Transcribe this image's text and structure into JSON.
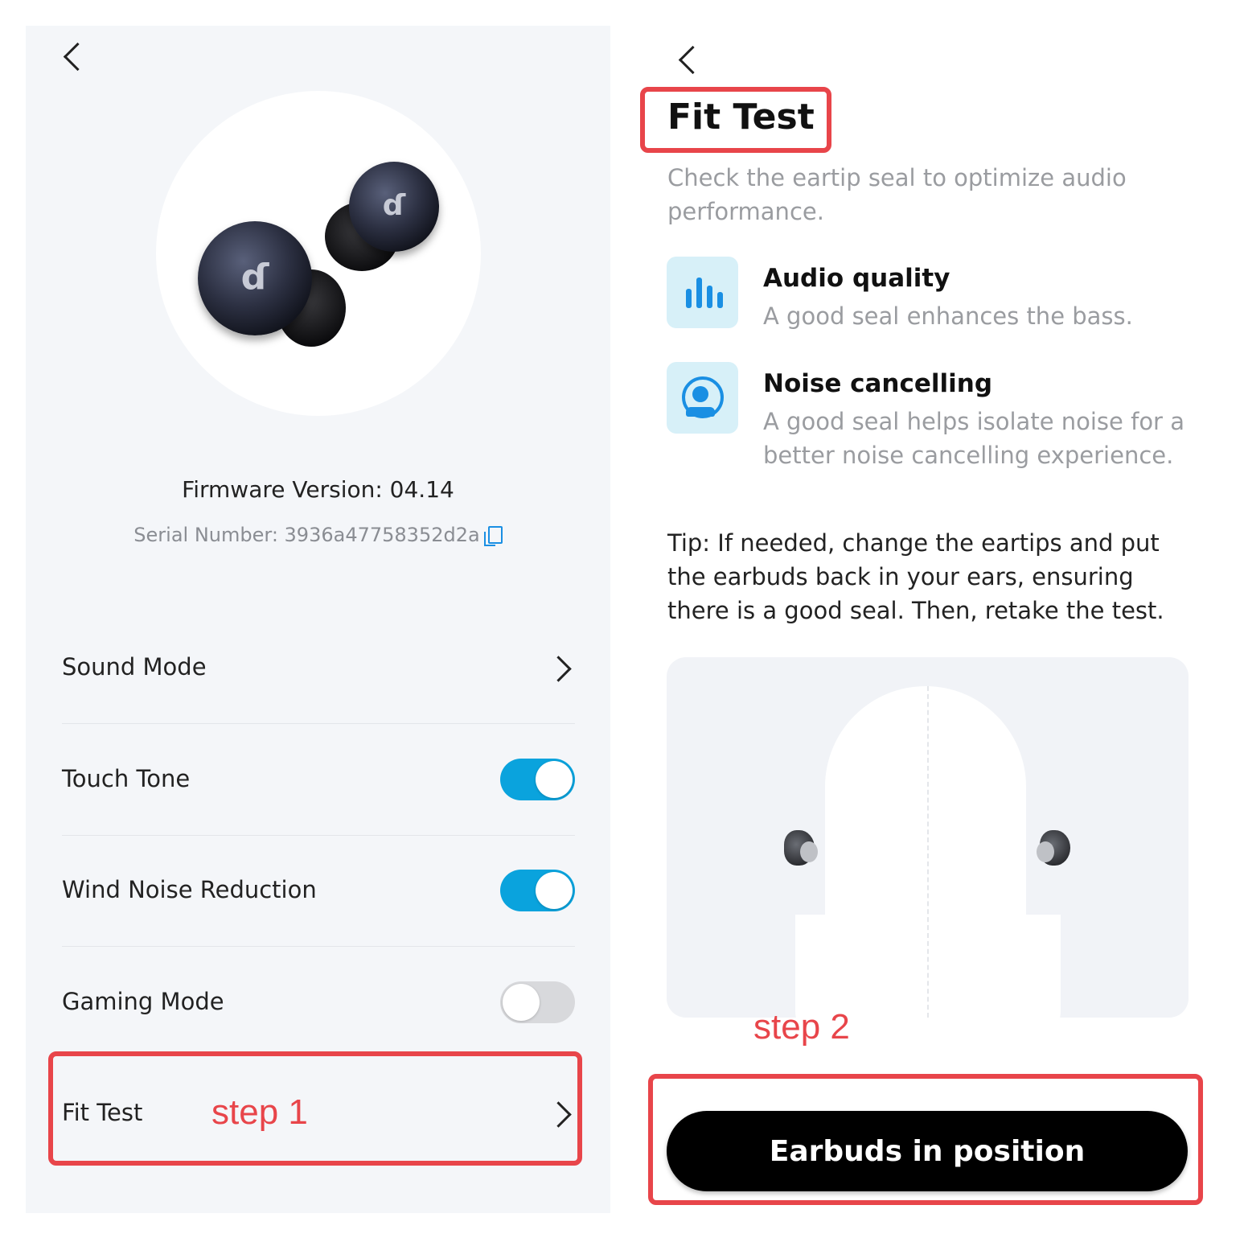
{
  "left_screen": {
    "firmware_version": "Firmware Version: 04.14",
    "serial_number": "Serial Number: 3936a47758352d2a",
    "device_logo_glyph": "ɗ",
    "settings": [
      {
        "label": "Sound Mode",
        "control": "chevron"
      },
      {
        "label": "Touch Tone",
        "control": "toggle",
        "on": true
      },
      {
        "label": "Wind Noise Reduction",
        "control": "toggle",
        "on": true
      },
      {
        "label": "Gaming Mode",
        "control": "toggle",
        "on": false
      },
      {
        "label": "Fit Test",
        "control": "chevron"
      }
    ],
    "annotation_step1": "step 1"
  },
  "right_screen": {
    "title": "Fit Test",
    "subtitle": "Check the eartip seal to optimize audio performance.",
    "features": [
      {
        "title": "Audio quality",
        "description": "A good seal enhances the bass.",
        "icon": "bar-chart-icon"
      },
      {
        "title": "Noise cancelling",
        "description": "A good seal helps isolate noise for a better noise cancelling experience.",
        "icon": "person-noise-icon"
      }
    ],
    "tip": "Tip: If needed, change the eartips and put the earbuds back in your ears, ensuring there is a good seal. Then, retake the test.",
    "annotation_step2": "step 2",
    "cta_label": "Earbuds in position"
  },
  "colors": {
    "accent": "#0aa3dd",
    "annotation_red": "#e8454a",
    "feature_icon_bg": "#d7f0f8",
    "feature_icon_fg": "#1a8fe3",
    "cta_bg": "#000000"
  }
}
